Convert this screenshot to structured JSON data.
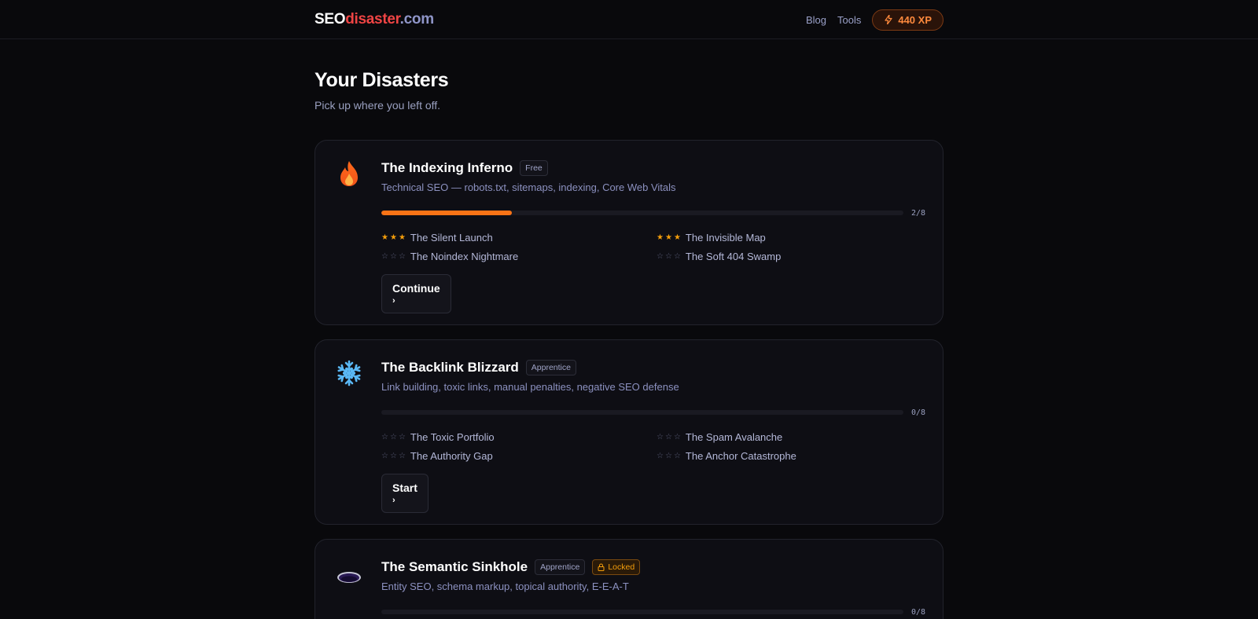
{
  "header": {
    "logo": {
      "part1": "SEO",
      "part2": "disaster",
      "part3": ".com"
    },
    "nav": [
      {
        "label": "Blog"
      },
      {
        "label": "Tools"
      }
    ],
    "xp": "440 XP"
  },
  "page": {
    "title": "Your Disasters",
    "subtitle": "Pick up where you left off."
  },
  "cards": [
    {
      "icon": "fire-icon",
      "title": "The Indexing Inferno",
      "badge": "Free",
      "description": "Technical SEO — robots.txt, sitemaps, indexing, Core Web Vitals",
      "progress": {
        "done": 2,
        "total": 8,
        "label": "2/8"
      },
      "levels": [
        {
          "name": "The Silent Launch",
          "stars": 3
        },
        {
          "name": "The Invisible Map",
          "stars": 3
        },
        {
          "name": "The Noindex Nightmare",
          "stars": 0
        },
        {
          "name": "The Soft 404 Swamp",
          "stars": 0
        }
      ],
      "cta": "Continue"
    },
    {
      "icon": "snowflake-icon",
      "title": "The Backlink Blizzard",
      "badge": "Apprentice",
      "description": "Link building, toxic links, manual penalties, negative SEO defense",
      "progress": {
        "done": 0,
        "total": 8,
        "label": "0/8"
      },
      "levels": [
        {
          "name": "The Toxic Portfolio",
          "stars": 0
        },
        {
          "name": "The Spam Avalanche",
          "stars": 0
        },
        {
          "name": "The Authority Gap",
          "stars": 0
        },
        {
          "name": "The Anchor Catastrophe",
          "stars": 0
        }
      ],
      "cta": "Start"
    },
    {
      "icon": "sinkhole-icon",
      "title": "The Semantic Sinkhole",
      "badge": "Apprentice",
      "locked": "Locked",
      "description": "Entity SEO, schema markup, topical authority, E-E-A-T",
      "progress": {
        "done": 0,
        "total": 8,
        "label": "0/8"
      }
    }
  ],
  "colors": {
    "accent": "#f97316",
    "star": "#f59e0b",
    "logo_red": "#ef4444"
  }
}
